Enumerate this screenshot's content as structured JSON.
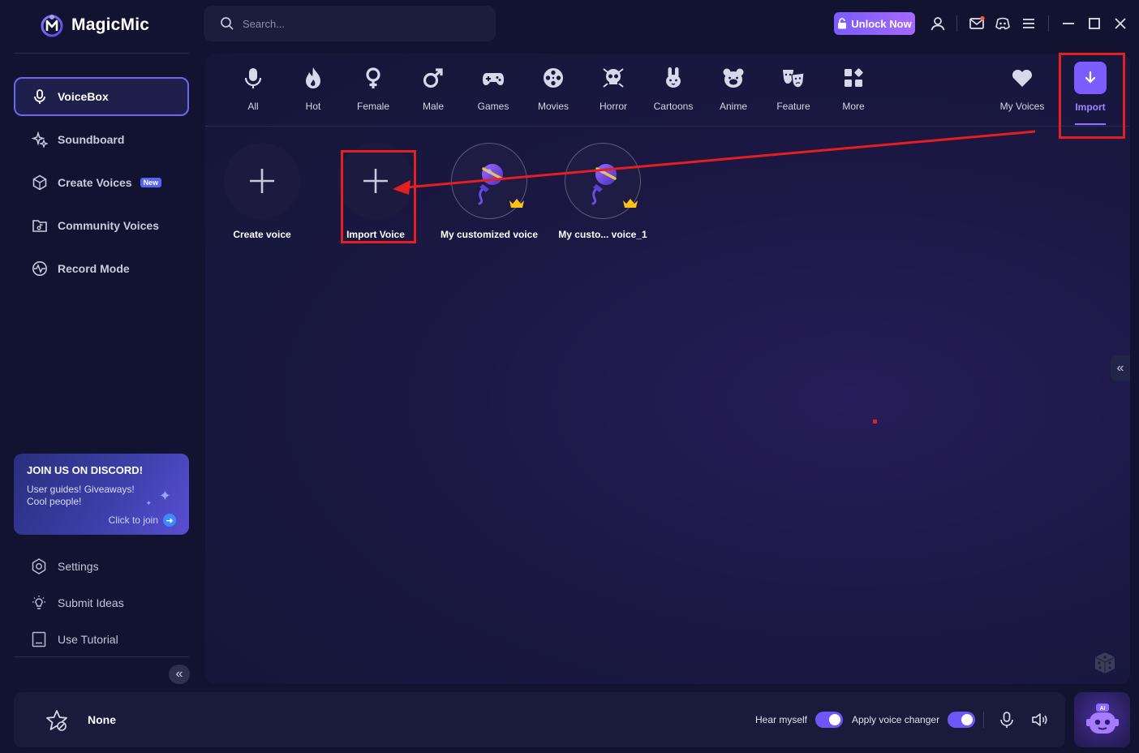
{
  "app": {
    "name": "MagicMic"
  },
  "search": {
    "placeholder": "Search..."
  },
  "header": {
    "unlock_label": "Unlock Now"
  },
  "sidebar": {
    "items": [
      {
        "label": "VoiceBox",
        "icon": "microphone-icon",
        "active": true
      },
      {
        "label": "Soundboard",
        "icon": "sparkle-icon",
        "active": false
      },
      {
        "label": "Create Voices",
        "icon": "hexagon-icon",
        "active": false,
        "badge": "New"
      },
      {
        "label": "Community Voices",
        "icon": "folder-music-icon",
        "active": false
      },
      {
        "label": "Record Mode",
        "icon": "waveform-icon",
        "active": false
      }
    ],
    "discord": {
      "title": "JOIN US ON DISCORD!",
      "subtitle": "User guides! Giveaways! Cool people!",
      "cta": "Click to join"
    },
    "bottom_links": [
      {
        "label": "Settings",
        "icon": "gear-icon"
      },
      {
        "label": "Submit Ideas",
        "icon": "lightbulb-icon"
      },
      {
        "label": "Use Tutorial",
        "icon": "book-icon"
      }
    ]
  },
  "categories": [
    {
      "label": "All",
      "icon": "microphone-icon"
    },
    {
      "label": "Hot",
      "icon": "flame-icon"
    },
    {
      "label": "Female",
      "icon": "female-symbol-icon"
    },
    {
      "label": "Male",
      "icon": "male-symbol-icon"
    },
    {
      "label": "Games",
      "icon": "gamepad-icon"
    },
    {
      "label": "Movies",
      "icon": "film-reel-icon"
    },
    {
      "label": "Horror",
      "icon": "skull-icon"
    },
    {
      "label": "Cartoons",
      "icon": "bunny-icon"
    },
    {
      "label": "Anime",
      "icon": "bear-icon"
    },
    {
      "label": "Feature",
      "icon": "masks-icon"
    },
    {
      "label": "More",
      "icon": "grid-icon"
    },
    {
      "label": "My Voices",
      "icon": "heart-icon"
    },
    {
      "label": "Import",
      "icon": "download-icon",
      "active": true
    }
  ],
  "voices": [
    {
      "label": "Create voice",
      "icon": "plus-icon"
    },
    {
      "label": "Import Voice",
      "icon": "plus-icon"
    },
    {
      "label": "My customized voice",
      "icon": "custom-voice-icon",
      "premium": true
    },
    {
      "label": "My custo... voice_1",
      "icon": "custom-voice-icon",
      "premium": true
    }
  ],
  "bottom_bar": {
    "current_voice": "None",
    "hear_myself_label": "Hear myself",
    "hear_myself_on": true,
    "apply_changer_label": "Apply voice changer",
    "apply_changer_on": true
  },
  "colors": {
    "accent": "#7a5cff",
    "annotation_red": "#e41f1f",
    "background": "#121330"
  }
}
